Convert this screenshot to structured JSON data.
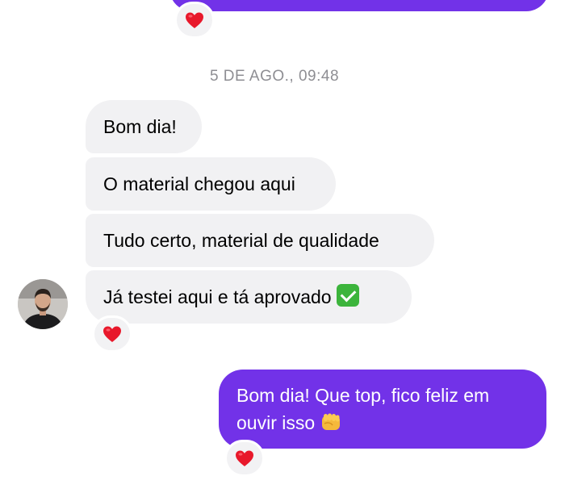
{
  "conversation": {
    "timestamp": "5 DE AGO., 09:48",
    "incoming_messages": [
      {
        "text": "Bom dia!"
      },
      {
        "text": "O material chegou aqui"
      },
      {
        "text": "Tudo certo, material de qualidade"
      },
      {
        "text": "Já testei aqui e tá aprovado",
        "emoji": "check-mark-button"
      }
    ],
    "outgoing_message": {
      "text": "Bom dia! Que top, fico feliz em ouvir isso",
      "emoji": "oncoming-fist"
    },
    "reactions": [
      "red-heart",
      "red-heart",
      "red-heart"
    ]
  },
  "colors": {
    "outgoing_bubble": "#7232E8",
    "incoming_bubble": "#F1F1F3",
    "timestamp_text": "#8E8E93",
    "reaction_heart": "#E8182B"
  },
  "icons": {
    "reaction": "heart-icon",
    "avatar": "avatar"
  }
}
